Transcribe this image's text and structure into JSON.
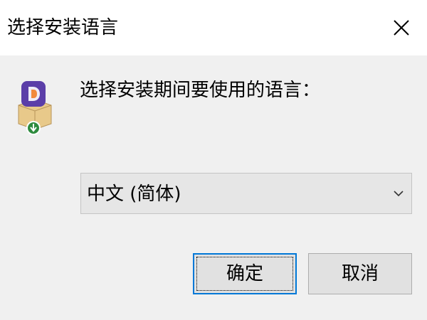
{
  "window": {
    "title": "选择安装语言",
    "close_icon": "close-icon"
  },
  "app_icon": "installer-app-icon",
  "prompt": "选择安装期间要使用的语言：",
  "language_select": {
    "selected": "中文 (简体)",
    "arrow_icon": "chevron-down-icon"
  },
  "buttons": {
    "ok_label": "确定",
    "cancel_label": "取消"
  },
  "colors": {
    "titlebar": "#ffffff",
    "body": "#f0f0f0",
    "focus_border": "#0078d7",
    "icon_purple": "#5b3ea8",
    "icon_box": "#e8c98a",
    "download_badge": "#2e8b3e"
  }
}
